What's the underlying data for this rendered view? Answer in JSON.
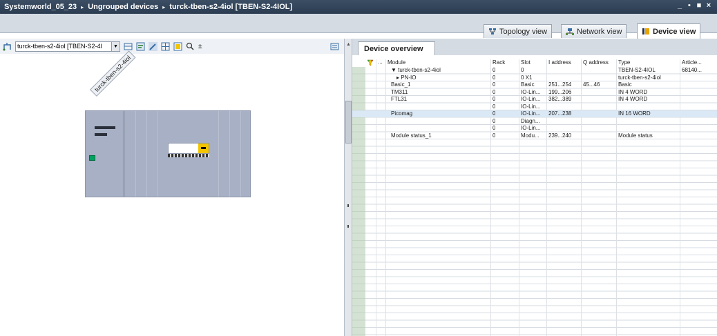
{
  "titlebar": {
    "crumbs": [
      "Systemworld_05_23",
      "Ungrouped devices",
      "turck-tben-s2-4iol [TBEN-S2-4IOL]"
    ],
    "sep": "▸",
    "controls": [
      "_",
      "▪",
      "■",
      "×"
    ]
  },
  "view_tabs": [
    {
      "label": "Topology view",
      "icon": "topology-icon"
    },
    {
      "label": "Network view",
      "icon": "network-icon"
    },
    {
      "label": "Device view",
      "icon": "device-icon"
    }
  ],
  "toolbar": {
    "device_select_value": "turck-tben-s2-4iol [TBEN-S2-4I",
    "zoom_suffix": "±"
  },
  "device_label": "turck-tben-s2-4iol",
  "device_overview": {
    "tab_label": "Device overview",
    "columns": [
      "...",
      "Module",
      "Rack",
      "Slot",
      "I address",
      "Q address",
      "Type",
      "Article..."
    ],
    "rows": [
      {
        "module": "▼ turck-tben-s2-4iol",
        "rack": "0",
        "slot": "0",
        "iaddr": "",
        "qaddr": "",
        "type": "TBEN-S2-4IOL",
        "article": "68140..."
      },
      {
        "module": "▸ PN-IO",
        "rack": "0",
        "slot": "0 X1",
        "iaddr": "",
        "qaddr": "",
        "type": "turck-tben-s2-4iol",
        "article": ""
      },
      {
        "module": "Basic_1",
        "rack": "0",
        "slot": "Basic",
        "iaddr": "251...254",
        "qaddr": "45...46",
        "type": "Basic",
        "article": ""
      },
      {
        "module": "TM311",
        "rack": "0",
        "slot": "IO-Lin...",
        "iaddr": "199...206",
        "qaddr": "",
        "type": "IN 4 WORD",
        "article": ""
      },
      {
        "module": "FTL31",
        "rack": "0",
        "slot": "IO-Lin...",
        "iaddr": "382...389",
        "qaddr": "",
        "type": "IN 4 WORD",
        "article": ""
      },
      {
        "module": "",
        "rack": "0",
        "slot": "IO-Lin...",
        "iaddr": "",
        "qaddr": "",
        "type": "",
        "article": ""
      },
      {
        "module": "Picomag",
        "rack": "0",
        "slot": "IO-Lin...",
        "iaddr": "207...238",
        "qaddr": "",
        "type": "IN 16 WORD",
        "article": ""
      },
      {
        "module": "",
        "rack": "0",
        "slot": "Diagn...",
        "iaddr": "",
        "qaddr": "",
        "type": "",
        "article": ""
      },
      {
        "module": "",
        "rack": "0",
        "slot": "IO-Lin...",
        "iaddr": "",
        "qaddr": "",
        "type": "",
        "article": ""
      },
      {
        "module": "Module status_1",
        "rack": "0",
        "slot": "Modu...",
        "iaddr": "239...240",
        "qaddr": "",
        "type": "Module status",
        "article": ""
      }
    ]
  }
}
